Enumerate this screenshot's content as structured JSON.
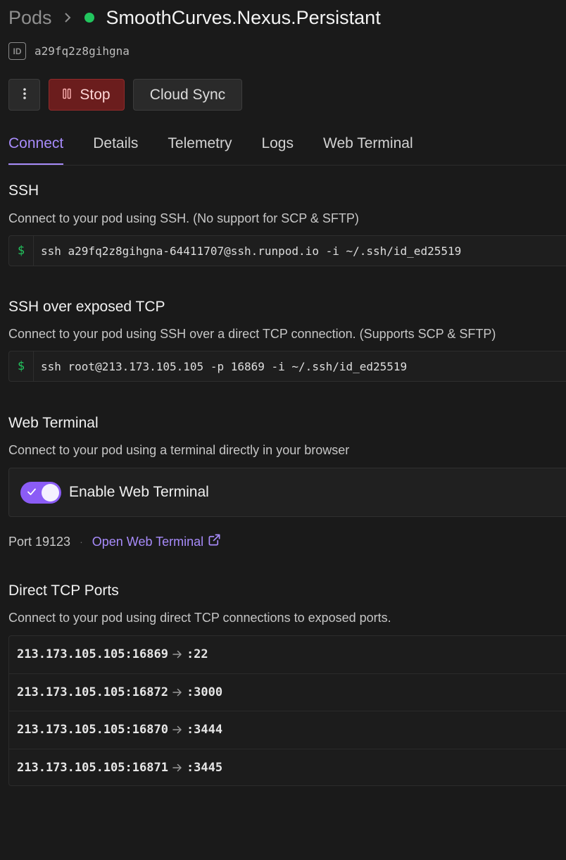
{
  "breadcrumb": {
    "root": "Pods",
    "pod_name": "SmoothCurves.Nexus.Persistant",
    "status_color": "#22c55e"
  },
  "pod": {
    "id_badge": "ID",
    "id": "a29fq2z8gihgna"
  },
  "actions": {
    "more_icon": "vertical-ellipsis-icon",
    "stop_label": "Stop",
    "stop_icon": "pause-icon",
    "cloud_sync_label": "Cloud Sync"
  },
  "tabs": [
    {
      "label": "Connect",
      "active": true
    },
    {
      "label": "Details",
      "active": false
    },
    {
      "label": "Telemetry",
      "active": false
    },
    {
      "label": "Logs",
      "active": false
    },
    {
      "label": "Web Terminal",
      "active": false
    }
  ],
  "ssh": {
    "title": "SSH",
    "description": "Connect to your pod using SSH. (No support for SCP & SFTP)",
    "prompt": "$",
    "command": "ssh a29fq2z8gihgna-64411707@ssh.runpod.io -i ~/.ssh/id_ed25519"
  },
  "ssh_tcp": {
    "title": "SSH over exposed TCP",
    "description": "Connect to your pod using SSH over a direct TCP connection. (Supports SCP & SFTP)",
    "prompt": "$",
    "command": "ssh root@213.173.105.105 -p 16869 -i ~/.ssh/id_ed25519"
  },
  "web_terminal": {
    "title": "Web Terminal",
    "description": "Connect to your pod using a terminal directly in your browser",
    "toggle_label": "Enable Web Terminal",
    "enabled": true,
    "port_label": "Port 19123",
    "separator": "·",
    "open_link": "Open Web Terminal"
  },
  "direct_tcp": {
    "title": "Direct TCP Ports",
    "description": "Connect to your pod using direct TCP connections to exposed ports.",
    "ports": [
      {
        "external": "213.173.105.105:16869",
        "internal": ":22"
      },
      {
        "external": "213.173.105.105:16872",
        "internal": ":3000"
      },
      {
        "external": "213.173.105.105:16870",
        "internal": ":3444"
      },
      {
        "external": "213.173.105.105:16871",
        "internal": ":3445"
      }
    ]
  },
  "colors": {
    "accent": "#a78bfa",
    "toggle": "#8b5cf6",
    "stop_bg": "#6b1d1d",
    "background": "#1a1a1a"
  }
}
